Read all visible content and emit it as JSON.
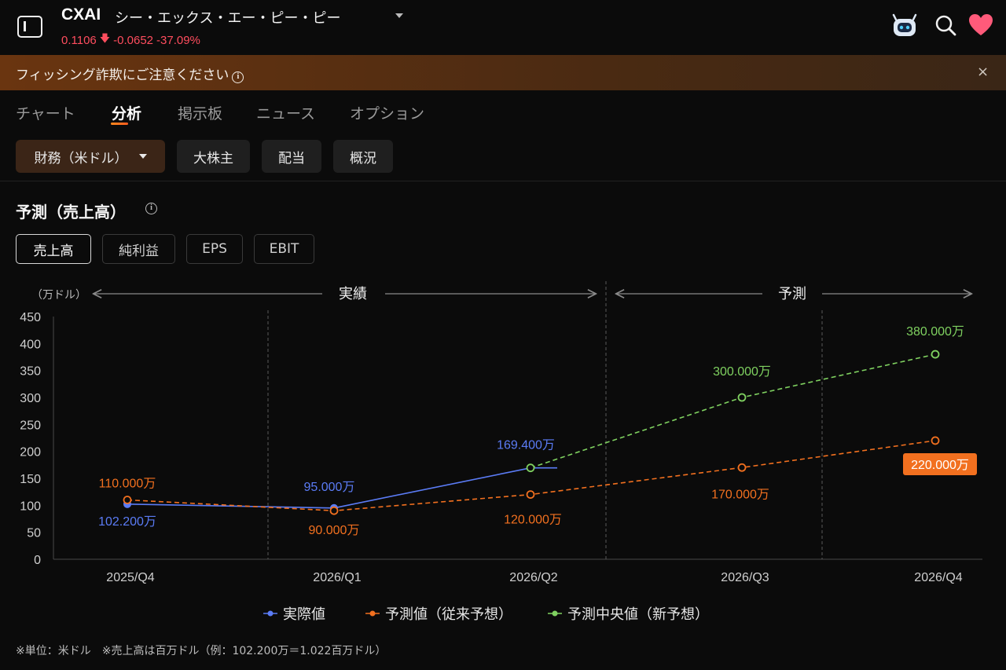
{
  "header": {
    "ticker": "CXAI",
    "company": "シー・エックス・エー・ピー・ピー",
    "price": "0.1106",
    "change": "-0.0652",
    "change_pct": "-37.09%",
    "down_color": "#ff4d5e"
  },
  "banner": {
    "text": "フィッシング詐欺にご注意ください",
    "info_glyph": "i",
    "close_glyph": "×"
  },
  "tabs": [
    "チャート",
    "分析",
    "掲示板",
    "ニュース",
    "オプション"
  ],
  "active_tab": "分析",
  "subtabs": [
    {
      "label": "財務（米ドル）",
      "active": true
    },
    {
      "label": "大株主",
      "active": false
    },
    {
      "label": "配当",
      "active": false
    },
    {
      "label": "概況",
      "active": false
    }
  ],
  "section": {
    "title": "予測（売上高）",
    "info_glyph": "i"
  },
  "metrics": [
    {
      "label": "売上高",
      "active": true
    },
    {
      "label": "純利益",
      "active": false
    },
    {
      "label": "EPS",
      "active": false
    },
    {
      "label": "EBIT",
      "active": false
    }
  ],
  "footnote": "※単位：米ドル　※売上高は百万ドル（例：102.200万＝1.022百万ドル）",
  "chart_data": {
    "type": "line",
    "unit_label": "（万ドル）",
    "period_labels": {
      "actual": "実績",
      "forecast": "予測"
    },
    "categories": [
      "2025/Q4",
      "2026/Q1",
      "2026/Q2",
      "2026/Q3",
      "2026/Q4"
    ],
    "ylim": [
      0,
      450
    ],
    "yticks": [
      0,
      50,
      100,
      150,
      200,
      250,
      300,
      350,
      400,
      450
    ],
    "series": [
      {
        "name": "実際値",
        "color": "#5b7cf6",
        "style": "solid",
        "marker": "filled",
        "values": [
          102.2,
          95.0,
          169.4,
          null,
          null
        ],
        "labels": [
          "102.200万",
          "95.000万",
          "169.400万",
          null,
          null
        ]
      },
      {
        "name": "予測値（従来予想）",
        "color": "#f2701f",
        "style": "dashed",
        "marker": "open",
        "values": [
          110.0,
          90.0,
          120.0,
          170.0,
          220.0
        ],
        "labels": [
          "110.000万",
          "90.000万",
          "120.000万",
          "170.000万",
          "220.000万"
        ]
      },
      {
        "name": "予測中央値（新予想）",
        "color": "#7fd160",
        "style": "dashed",
        "marker": "open",
        "values": [
          null,
          null,
          169.4,
          300.0,
          380.0
        ],
        "labels": [
          null,
          null,
          null,
          "300.000万",
          "380.000万"
        ]
      }
    ],
    "highlight_label": "220.000万",
    "legend_position": "bottom",
    "grid": false
  }
}
